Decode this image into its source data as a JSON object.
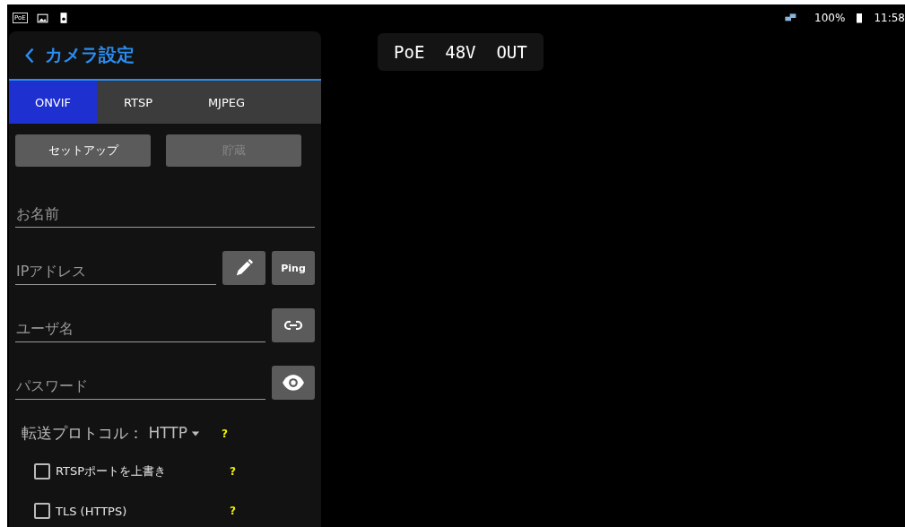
{
  "status_bar": {
    "poe_label": "PoE",
    "battery": "100%",
    "time": "11:58"
  },
  "panel": {
    "title": "カメラ設定",
    "tabs": [
      {
        "label": "ONVIF",
        "selected": true
      },
      {
        "label": "RTSP",
        "selected": false
      },
      {
        "label": "MJPEG",
        "selected": false
      }
    ],
    "actions": [
      {
        "label": "セットアップ",
        "disabled": false
      },
      {
        "label": "貯蔵",
        "disabled": true
      }
    ],
    "fields": [
      {
        "placeholder": "お名前",
        "kind": "plain"
      },
      {
        "placeholder": "IPアドレス",
        "kind": "ip",
        "ping": "Ping"
      },
      {
        "placeholder": "ユーザ名",
        "kind": "link"
      },
      {
        "placeholder": "パスワード",
        "kind": "eye"
      }
    ],
    "protocol": {
      "label": "転送プロトコル：",
      "value": "HTTP",
      "help": "?"
    },
    "options": [
      {
        "label": "RTSPポートを上書き",
        "checked": false,
        "help": "?"
      },
      {
        "label": "TLS (HTTPS)",
        "checked": false,
        "help": "?"
      }
    ]
  },
  "poe_output": "PoE  48V  OUT"
}
